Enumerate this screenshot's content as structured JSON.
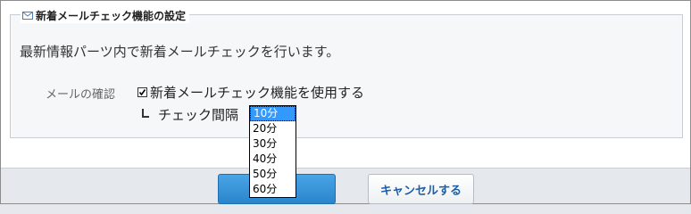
{
  "section": {
    "title": "新着メールチェック機能の設定",
    "description": "最新情報パーツ内で新着メールチェックを行います。"
  },
  "mail_check": {
    "label": "メールの確認",
    "checkbox_label": "新着メールチェック機能を使用する",
    "checked": true
  },
  "interval": {
    "label": "チェック間隔",
    "options": [
      "10分",
      "20分",
      "30分",
      "40分",
      "50分",
      "60分"
    ],
    "selected": "10分"
  },
  "buttons": {
    "cancel": "キャンセルする"
  }
}
